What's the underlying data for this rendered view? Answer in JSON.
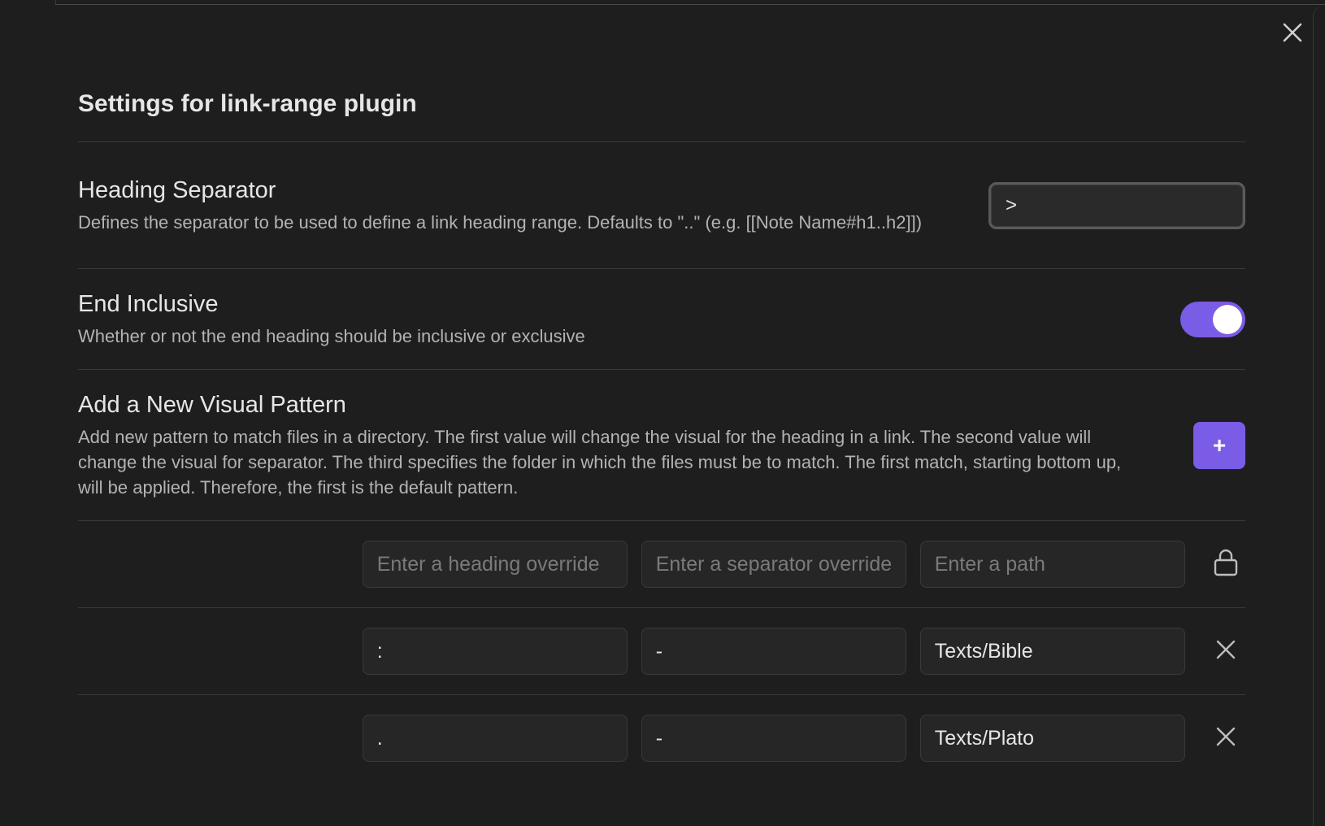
{
  "modal": {
    "title": "Settings for link-range plugin",
    "close_icon": "close-icon"
  },
  "settings": {
    "heading_separator": {
      "name": "Heading Separator",
      "description": "Defines the separator to be used to define a link heading range. Defaults to \"..\" (e.g. [[Note Name#h1..h2]])",
      "value": ">"
    },
    "end_inclusive": {
      "name": "End Inclusive",
      "description": "Whether or not the end heading should be inclusive or exclusive",
      "enabled": true
    },
    "add_pattern": {
      "name": "Add a New Visual Pattern",
      "description": "Add new pattern to match files in a directory. The first value will change the visual for the heading in a link. The second value will change the visual for separator. The third specifies the folder in which the files must be to match. The first match, starting bottom up, will be applied. Therefore, the first is the default pattern.",
      "button_label": "+"
    }
  },
  "patterns": {
    "default": {
      "heading_placeholder": "Enter a heading override",
      "separator_placeholder": "Enter a separator override",
      "path_placeholder": "Enter a path",
      "heading_value": "",
      "separator_value": "",
      "path_value": "",
      "icon": "lock-icon"
    },
    "rows": [
      {
        "heading": ":",
        "separator": "-",
        "path": "Texts/Bible",
        "icon": "close-icon"
      },
      {
        "heading": ".",
        "separator": "-",
        "path": "Texts/Plato",
        "icon": "close-icon"
      }
    ]
  },
  "colors": {
    "accent": "#7b5ce6",
    "background": "#1e1e1e"
  }
}
